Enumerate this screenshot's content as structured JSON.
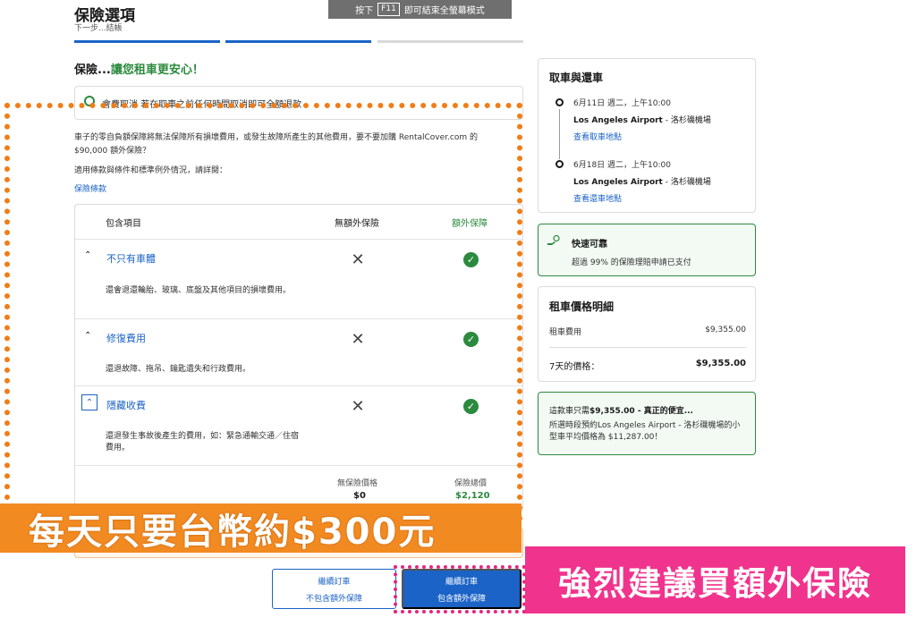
{
  "header": {
    "title": "保險選項",
    "subtitle": "下一步...結帳",
    "fullscreen_prefix": "按下",
    "fullscreen_key": "F11",
    "fullscreen_suffix": "即可結束全螢幕模式"
  },
  "insurance": {
    "headline_prefix": "保險...",
    "headline_green": "讓您租車更安心！",
    "promo_text": "會費取消 若在取車之前任何時間取消即可全額退款",
    "para_1": "車子的零自負額保障將無法保障所有損壞費用，或發生故障所產生的其他費用，要不要加購 RentalCover.com 的 $90,000 額外保險？",
    "para_2": "適用條款與條件和標準例外情況，請詳閱：",
    "terms_link": "保險條款",
    "table": {
      "col_included": "包含項目",
      "col_none": "無額外保險",
      "col_extra": "額外保障",
      "rows": [
        {
          "title": "不只有車體",
          "desc": "還會退還輪胎、玻璃、底盤及其他項目的損壞費用。"
        },
        {
          "title": "修復費用",
          "desc": "還退故障、拖吊、鑰匙遺失和行政費用。"
        },
        {
          "title": "隱藏收費",
          "desc": "還退發生事故後產生的費用，如：緊急通輸交通／住宿費用。"
        }
      ],
      "total_none_label": "無保險價格",
      "total_none_value": "$0",
      "total_extra_label": "保險總價",
      "total_extra_value": "$2,120"
    }
  },
  "sidebar": {
    "pickup_title": "取車與還車",
    "pickup": {
      "date": "6月11日 週二，上午10:00",
      "place_bold": "Los Angeles Airport",
      "place_rest": " - 洛杉磯機場",
      "link": "查看取車地點"
    },
    "dropoff": {
      "date": "6月18日 週二，上午10:00",
      "place_bold": "Los Angeles Airport",
      "place_rest": " - 洛杉磯機場",
      "link": "查看還車地點"
    },
    "reliable_title": "快速可靠",
    "reliable_desc": "超過 99% 的保險理賠申請已支付",
    "price_title": "租車價格明細",
    "fee_label": "租車費用",
    "fee_value": "$9,355.00",
    "days_label": "7天的價格：",
    "days_value": "$9,355.00",
    "deal_prefix": "這款車只需",
    "deal_bold": "$9,355.00 - 真正的便宜...",
    "deal_desc": "所選時段預約Los Angeles Airport - 洛杉磯機場的小型車平均價格為 $11,287.00！"
  },
  "buttons": {
    "without_line1": "繼續訂車",
    "without_line2": "不包含額外保障",
    "with_line1": "繼續訂車",
    "with_line2": "包含額外保障"
  },
  "overlays": {
    "orange_banner": "每天只要台幣約$300元",
    "pink_banner": "強烈建議買額外保險"
  },
  "colors": {
    "accent_blue": "#1b63c6",
    "success_green": "#2b8a3e",
    "overlay_orange": "#f28a22",
    "overlay_pink": "#f0338c"
  },
  "icons": {
    "row_expand": "chevron-up-icon",
    "not_included": "x-mark-icon",
    "included": "check-circle-icon",
    "promo": "refund-icon",
    "reliable": "money-hand-icon"
  }
}
